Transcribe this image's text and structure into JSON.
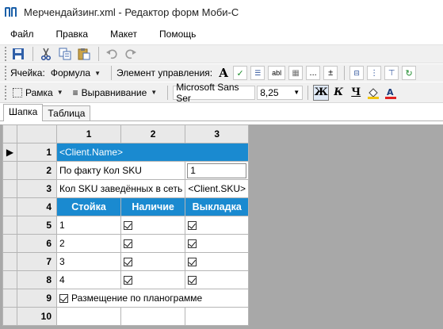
{
  "window": {
    "title": "Мерчендайзинг.xml - Редактор форм Моби-С"
  },
  "menu": {
    "items": [
      "Файл",
      "Правка",
      "Макет",
      "Помощь"
    ]
  },
  "toolbar": {
    "cell_label": "Ячейка:",
    "cell_type": "Формула",
    "control_label": "Элемент управления:",
    "control_abl": "abl",
    "control_dots": "...",
    "control_plus": "±"
  },
  "format_bar": {
    "frame_label": "Рамка",
    "align_label": "Выравнивание",
    "font_name": "Microsoft Sans Ser",
    "font_size": "8,25",
    "bold_label": "Ж",
    "italic_label": "К",
    "underline_label": "Ч"
  },
  "tabs": [
    {
      "label": "Шапка",
      "active": true
    },
    {
      "label": "Таблица",
      "active": false
    }
  ],
  "grid": {
    "column_headers": [
      "1",
      "2",
      "3"
    ],
    "row_headers": [
      "1",
      "2",
      "3",
      "4",
      "5",
      "6",
      "7",
      "8",
      "9",
      "10"
    ],
    "row1": "<Client.Name>",
    "row2": {
      "label": "По факту Кол SKU",
      "value": "1"
    },
    "row3": {
      "label": "Кол SKU заведённых в сеть",
      "value": "<Client.SKU>"
    },
    "row4": [
      "Стойка",
      "Наличие",
      "Выкладка"
    ],
    "data_rows": [
      {
        "stand": "1"
      },
      {
        "stand": "2"
      },
      {
        "stand": "3"
      },
      {
        "stand": "4"
      }
    ],
    "row9": "Размещение по планограмме"
  },
  "colors": {
    "header_blue": "#1a8ad0",
    "background_gray": "#a8a8a8"
  }
}
